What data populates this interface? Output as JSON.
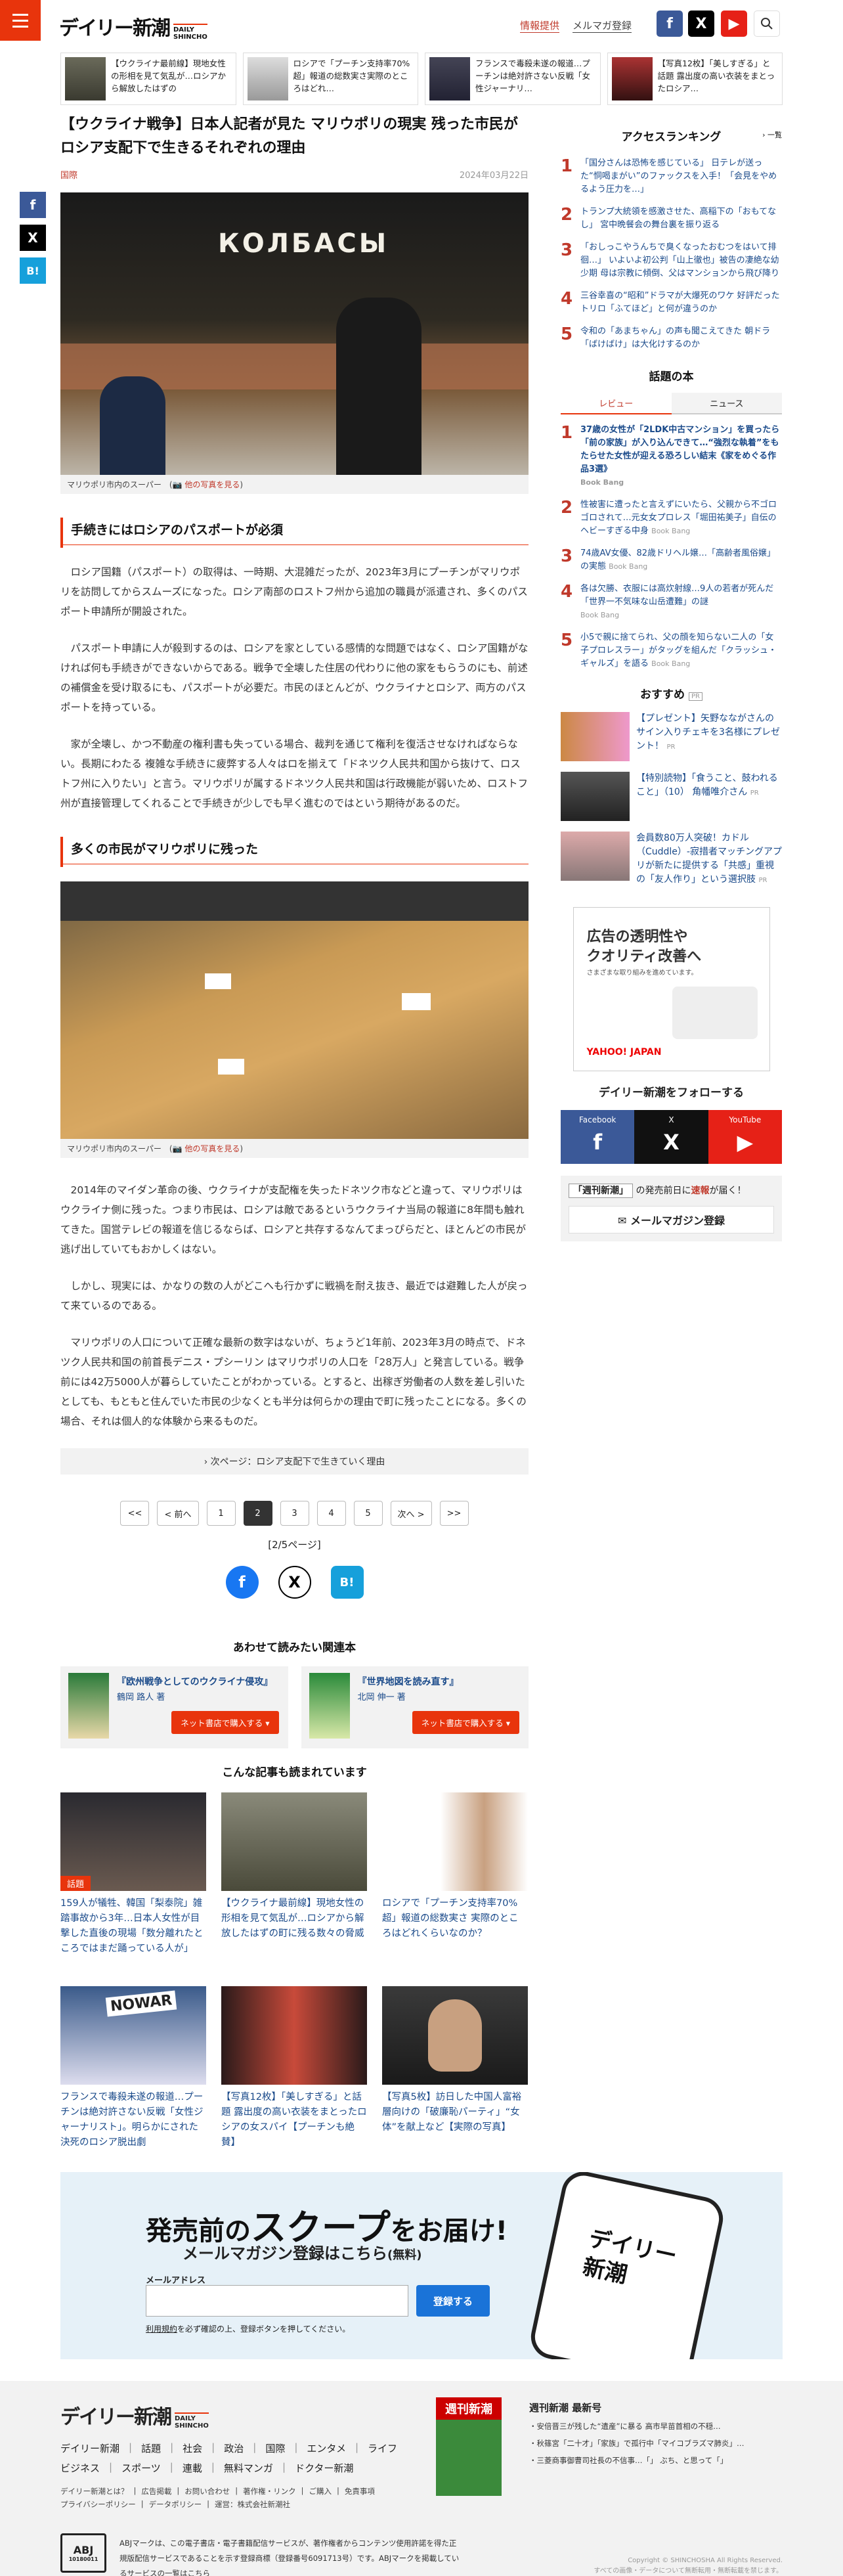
{
  "header": {
    "logo_jp": "デイリー新潮",
    "logo_en1": "DAILY",
    "logo_en2": "SHINCHO",
    "link_info": "情報提供",
    "link_mail": "メルマガ登録"
  },
  "strip": [
    {
      "text": "【ウクライナ最前線】現地女性の形相を見て気乱が…ロシアから解放したはずの"
    },
    {
      "text": "ロシアで「プーチン支持率70%超」報道の総数実さ実際のところはどれ…"
    },
    {
      "text": "フランスで毒殺未遂の報道…プーチンは絶対許さない反戦「女性ジャーナリ…"
    },
    {
      "text": "【写真12枚】「美しすぎる」と話題 露出度の高い衣装をまとったロシア…"
    }
  ],
  "article": {
    "title": "【ウクライナ戦争】日本人記者が見た マリウポリの現実 残った市民がロシア支配下で生きるそれぞれの理由",
    "category": "国際",
    "date": "2024年03月22日",
    "photo1_caption": "マリウポリ市内のスーパー",
    "photo2_caption": "マリウポリ市内のスーパー",
    "more_photos": "他の写真を見る",
    "photo1_sign": "КОЛБАСЫ",
    "h1": "手続きにはロシアのパスポートが必須",
    "p1": "ロシア国籍（パスポート）の取得は、一時期、大混雑だったが、2023年3月にプーチンがマリウポリを訪問してからスムーズになった。ロシア南部のロストフ州から追加の職員が派遣され、多くのパスポート申請所が開設された。",
    "p2": "パスポート申請に人が殺到するのは、ロシアを家としている感情的な問題ではなく、ロシア国籍がなければ何も手続きができないからである。戦争で全壊した住居の代わりに他の家をもらうのにも、前述の補償金を受け取るにも、パスポートが必要だ。市民のほとんどが、ウクライナとロシア、両方のパスポートを持っている。",
    "p3": "家が全壊し、かつ不動産の権利書も失っている場合、裁判を通じて権利を復活させなければならない。長期にわたる 複雑な手続きに疲弊する人々はロを揃えて「ドネツク人民共和国から抜けて、ロストフ州に入りたい」と言う。マリウポリが属するドネツク人民共和国は行政機能が弱いため、ロストフ州が直接管理してくれることで手続きが少しでも早く進むのではという期待があるのだ。",
    "h2": "多くの市民がマリウポリに残った",
    "p4": "2014年のマイダン革命の後、ウクライナが支配権を失ったドネツク市などと違って、マリウポリはウクライナ側に残った。つまり市民は、ロシアは敵であるというウクライナ当局の報道に8年間も触れてきた。国営テレビの報道を信じるならば、ロシアと共存するなんてまっぴらだと、ほとんどの市民が逃げ出していてもおかしくはない。",
    "p5": "しかし、現実には、かなりの数の人がどこへも行かずに戦禍を耐え抜き、最近では避難した人が戻って来ているのである。",
    "p6": "マリウポリの人口について正確な最新の数字はないが、ちょうど1年前、2023年3月の時点で、ドネツク人民共和国の前首長デニス・プシーリン はマリウポリの人口を「28万人」と発言している。戦争前には42万5000人が暮らしていたことがわかっている。とすると、出稼ぎ労働者の人数を差し引いたとしても、もともと住んでいた市民の少なくとも半分は何らかの理由で町に残ったことになる。多くの場合、それは個人的な体験から来るものだ。",
    "nextpage": "次ページ：ロシア支配下で生きていく理由",
    "pager": [
      "<<",
      "< 前へ",
      "1",
      "2",
      "3",
      "4",
      "5",
      "次へ >",
      ">>"
    ],
    "current_page": "2",
    "pageof": "[2/5ページ]"
  },
  "related": {
    "title": "あわせて読みたい関連本",
    "books": [
      {
        "title": "『欧州戦争としてのウクライナ侵攻』",
        "author": "鶴岡 路人 著",
        "buy": "ネット書店で購入する"
      },
      {
        "title": "『世界地図を読み直す』",
        "author": "北岡 伸一 著",
        "buy": "ネット書店で購入する"
      }
    ]
  },
  "also": {
    "title": "こんな記事も読まれています",
    "items": [
      {
        "text": "159人が犠牲、韓国「梨泰院」雑踏事故から3年…日本人女性が目撃した直後の現場「数分離れたところではまだ踊っている人が」",
        "tag": "話題"
      },
      {
        "text": "【ウクライナ最前線】現地女性の形相を見て気乱が…ロシアから解放したはずの町に残る数々の脅威",
        "tag": ""
      },
      {
        "text": "ロシアで「プーチン支持率70%超」報道の総数実さ 実際のところはどれくらいなのか？",
        "tag": ""
      },
      {
        "text": "フランスで毒殺未遂の報道…プーチンは絶対許さない反戦「女性ジャーナリスト」。明らかにされた決死のロシア脱出劇",
        "tag": ""
      },
      {
        "text": "【写真12枚】「美しすぎる」と話題 露出度の高い衣装をまとったロシアの女スパイ【プーチンも絶賛】",
        "tag": ""
      },
      {
        "text": "【写真5枚】訪日した中国人富裕層向けの「破廉恥パーティ」“女体”を献上など【実際の写真】",
        "tag": ""
      }
    ],
    "news_board": "NOWAR"
  },
  "sidebar": {
    "ranking_title": "アクセスランキング",
    "ranking_link": "一覧",
    "ranking": [
      {
        "n": "1",
        "text": "「国分さんは恐怖を感じている」 日テレが送った“恫喝まがい”のファックスを入手！「会見をやめるよう圧力を…」"
      },
      {
        "n": "2",
        "text": "トランプ大統領を感激させた、高稲下の「おもてなし」 宮中晩餐会の舞台裏を振り返る"
      },
      {
        "n": "3",
        "text": "「おしっこやうんちで臭くなったおむつをはいて排徊…」 いよいよ初公判「山上徹也」被告の凄絶な幼少期 母は宗教に傾倒、父はマンションから飛び降り"
      },
      {
        "n": "4",
        "text": "三谷幸喜の“昭和”ドラマが大爆死のワケ 好評だったトリロ「ふてほど」と何が違うのか"
      },
      {
        "n": "5",
        "text": "令和の「あまちゃん」の声も聞こえてきた 朝ドラ「ばけばけ」は大化けするのか"
      }
    ],
    "books_title": "話題の本",
    "tabs": [
      "レビュー",
      "ニュース"
    ],
    "book_items": [
      {
        "n": "1",
        "text": "37歳の女性が「2LDK中古マンション」を買ったら「前の家族」が入り込んできて…“強烈な執着”をもたらせた女性が迎える恐ろしい結末《家をめぐる作品3選》",
        "src": "Book Bang"
      },
      {
        "n": "2",
        "text": "性被害に遭ったと言えずにいたら、父親から不ゴロゴロされて…元女女プロレス「堀田祐美子」自伝のヘビーすぎる中身",
        "src": "Book Bang"
      },
      {
        "n": "3",
        "text": "74歳AV女優、82歳ドリヘル嬢…「高齢者風俗嬢」の実態",
        "src": "Book Bang"
      },
      {
        "n": "4",
        "text": "各は欠勝、衣服には高炊射線…9人の若者が死んだ「世界一不気味な山岳遭難」の謎",
        "src": "Book Bang"
      },
      {
        "n": "5",
        "text": "小5で親に捨てられ、父の顔を知らない二人の「女子プロレスラー」がタッグを組んだ「クラッシュ・ギャルズ」を語る",
        "src": "Book Bang"
      }
    ],
    "recommend_title": "おすすめ",
    "recommend_pr": "PR",
    "recommend": [
      {
        "text": "【プレゼント】矢野なながさんのサイン入りチェキを3名様にプレゼント！",
        "src": "PR"
      },
      {
        "text": "【特別読物】「食うこと、鼓われること」（10） 角幡唯介さん",
        "src": "PR"
      },
      {
        "text": "会員数80万人突破！カドル（Cuddle）-寂措者マッチングアプリが新たに提供する「共感」重視の「友人作り」という選択肢",
        "src": "PR"
      }
    ],
    "ad": {
      "line1": "広告の透明性や",
      "line2": "クオリティ改善へ",
      "line3": "さまざまな取り組みを進めています。",
      "logo": "YAHOO! JAPAN"
    },
    "follow_title": "デイリー新潮をフォローする",
    "follow": [
      {
        "label": "Facebook",
        "icon": "f"
      },
      {
        "label": "X",
        "icon": "X"
      },
      {
        "label": "YouTube",
        "icon": "▶"
      }
    ],
    "ws_line_a": "「週刊新潮」",
    "ws_line_b": "の発売前日に",
    "ws_line_c": "速報",
    "ws_line_d": "が届く！",
    "ws_register": "メールマガジン登録"
  },
  "mail": {
    "line1a": "発売前の",
    "line1b": "スクープ",
    "line1c": "をお届け!",
    "line2a": "メールマガジン登録はこちら",
    "line2b": "(無料)",
    "label": "メールアドレス",
    "button": "登録する",
    "note_a": "利用規約",
    "note_b": "を必ず確認の上、登録ボタンを押してください。",
    "phone_text1": "デイリー",
    "phone_text2": "新潮"
  },
  "footer": {
    "nav1": [
      "デイリー新潮",
      "話題",
      "社会",
      "政治",
      "国際",
      "エンタメ",
      "ライフ"
    ],
    "nav2": [
      "ビジネス",
      "スポーツ",
      "連載",
      "無料マンガ",
      "ドクター新潮"
    ],
    "small1": [
      "デイリー新潮とは？",
      "広告掲載",
      "お問い合わせ",
      "著作権・リンク",
      "ご購入",
      "免責事項"
    ],
    "small2": [
      "プライバシーポリシー",
      "データポリシー",
      "運営：株式会社新潮社"
    ],
    "mag_title": "週刊新潮 最新号",
    "mag_cover": "週刊新潮",
    "mag_items": [
      "安倍晋三が残した“遺産”に暴る 高市早苗首相の不穏…",
      "秋篠宮「二十才」「家族」で孤行中「マイコブラズマ肺炎」…",
      "三菱商事御曹司社長の不信事…「」 ぶち、と思って「」"
    ],
    "abj_label": "ABJ",
    "abj_code": "10180011",
    "abj_text": "ABJマークは、この電子書店・電子書籍配信サービスが、著作権者からコンテンツ使用許諾を得た正規版配信サービスであることを示す登録商標（登録番号6091713号）です。ABJマークを掲載しているサービスの一覧はこちら",
    "copy1": "Copyright © SHINCHOSHA All Rights Reserved.",
    "copy2": "すべての画像・データについて無断転用・無断転載を禁じます。"
  }
}
